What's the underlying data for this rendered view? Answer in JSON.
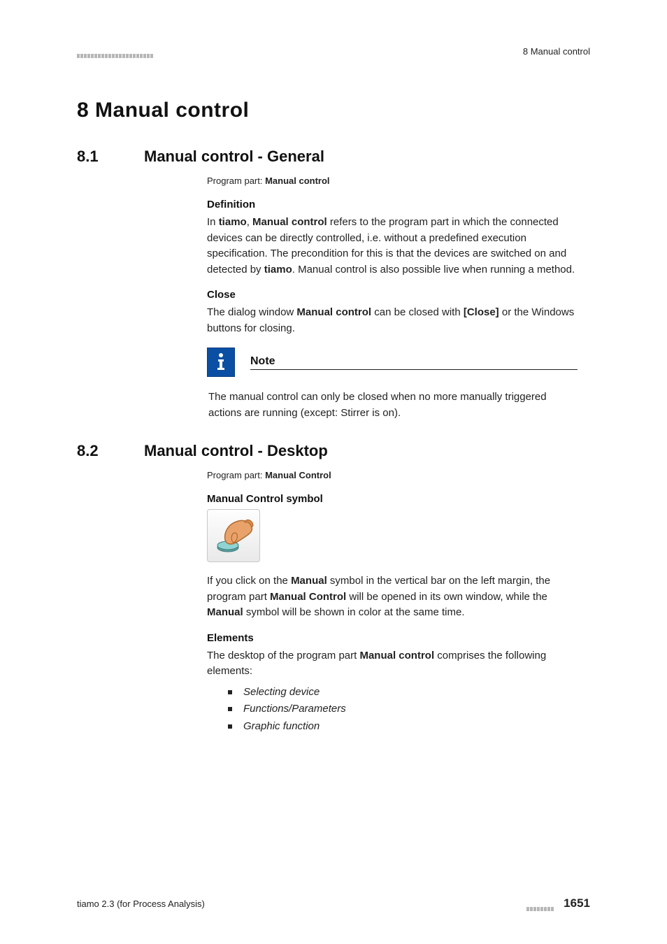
{
  "header": {
    "right_text": "8 Manual control"
  },
  "chapter": {
    "title": "8   Manual control"
  },
  "section1": {
    "num": "8.1",
    "title": "Manual control - General",
    "program_part_label": "Program part: ",
    "program_part_value": "Manual control",
    "def_head": "Definition",
    "def_para_1a": "In ",
    "def_para_1b": "tiamo",
    "def_para_1c": ", ",
    "def_para_1d": "Manual control",
    "def_para_1e": " refers to the program part in which the connected devices can be directly controlled, i.e. without a predefined execution specification. The precondition for this is that the devices are switched on and detected by ",
    "def_para_1f": "tiamo",
    "def_para_1g": ". Manual control is also possible live when running a method.",
    "close_head": "Close",
    "close_a": "The dialog window ",
    "close_b": "Manual control",
    "close_c": " can be closed with ",
    "close_d": "[Close]",
    "close_e": " or the Windows buttons for closing.",
    "note_title": "Note",
    "note_body": "The manual control can only be closed when no more manually triggered actions are running (except: Stirrer is on)."
  },
  "section2": {
    "num": "8.2",
    "title": "Manual control - Desktop",
    "program_part_label": "Program part: ",
    "program_part_value": "Manual Control",
    "symbol_head": "Manual Control symbol",
    "symbol_para_a": "If you click on the ",
    "symbol_para_b": "Manual",
    "symbol_para_c": " symbol in the vertical bar on the left margin, the program part ",
    "symbol_para_d": "Manual Control",
    "symbol_para_e": " will be opened in its own window, while the ",
    "symbol_para_f": "Manual",
    "symbol_para_g": " symbol will be shown in color at the same time.",
    "elements_head": "Elements",
    "elements_para_a": "The desktop of the program part ",
    "elements_para_b": "Manual control",
    "elements_para_c": " comprises the following elements:",
    "bullets": [
      "Selecting device",
      "Functions/Parameters",
      "Graphic function"
    ]
  },
  "footer": {
    "left": "tiamo 2.3 (for Process Analysis)",
    "page": "1651"
  }
}
